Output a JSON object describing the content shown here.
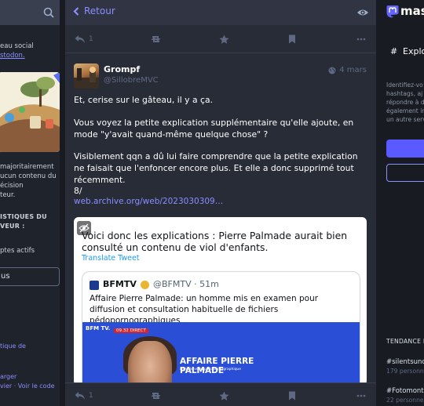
{
  "left": {
    "intro_line1": "eau social",
    "intro_line2": "stodon.",
    "notice": [
      "majoritairement",
      "ucun contenu du",
      "écision",
      "teur."
    ],
    "stats_heading": [
      "ISTIQUES DU",
      "VEUR :"
    ],
    "stats_item": "ptes actifs",
    "button_label": "us",
    "footer": [
      "tique de",
      "arger",
      "vier · Voir le code"
    ]
  },
  "center": {
    "back_label": "Retour",
    "reply_count": "1",
    "author": {
      "name": "Grompf",
      "handle": "@SillobreMVC"
    },
    "time": "4 mars",
    "paragraphs": [
      "Et, cerise sur le gâteau, il y a ça.",
      "Vous voyez la petite explication supplémentaire qu'elle ajoute, en mode \"y'avait quand-même quelque chose\" ?",
      "Visiblement qqn a dû lui faire comprendre que la petite explication ne faisait que l'enfoncer encore plus. Et elle a donc supprimé tout récemment.",
      "8/"
    ],
    "link": "web.archive.org/web/2023030309…",
    "tweet": {
      "text": "Voici donc les explications : Pierre Palmade aurait bien consulté un contenu de viol d'enfants.",
      "translate": "Translate Tweet",
      "quote": {
        "name": "BFMTV",
        "handle_time": "@BFMTV · 51m",
        "text": "Affaire Pierre Palmade: un homme mis en examen pour diffusion et consultation habituelle de fichiers pédopornographiques",
        "image": {
          "corner": "BFM TV.",
          "tag": "09.32 DIRECT",
          "headline": "AFFAIRE PIERRE PALMADE",
          "subheadline": "Dans le volet pédopornographique"
        }
      }
    }
  },
  "right": {
    "logo_text": "masto",
    "explore_label": "Explo",
    "description": [
      "Identifiez-vo",
      "hashtags, aj",
      "répondre à d",
      "également ir",
      "un autre serv"
    ],
    "trends_title": "TENDANCE E",
    "trends": [
      {
        "tag": "#silentsunc",
        "meta": "179 personn"
      },
      {
        "tag": "#Fotomont",
        "meta": "22 personne"
      }
    ]
  },
  "colors": {
    "accent": "#8c8dff",
    "primary_button": "#595aff",
    "column_bg": "#282c37",
    "page_bg": "#191b22"
  }
}
